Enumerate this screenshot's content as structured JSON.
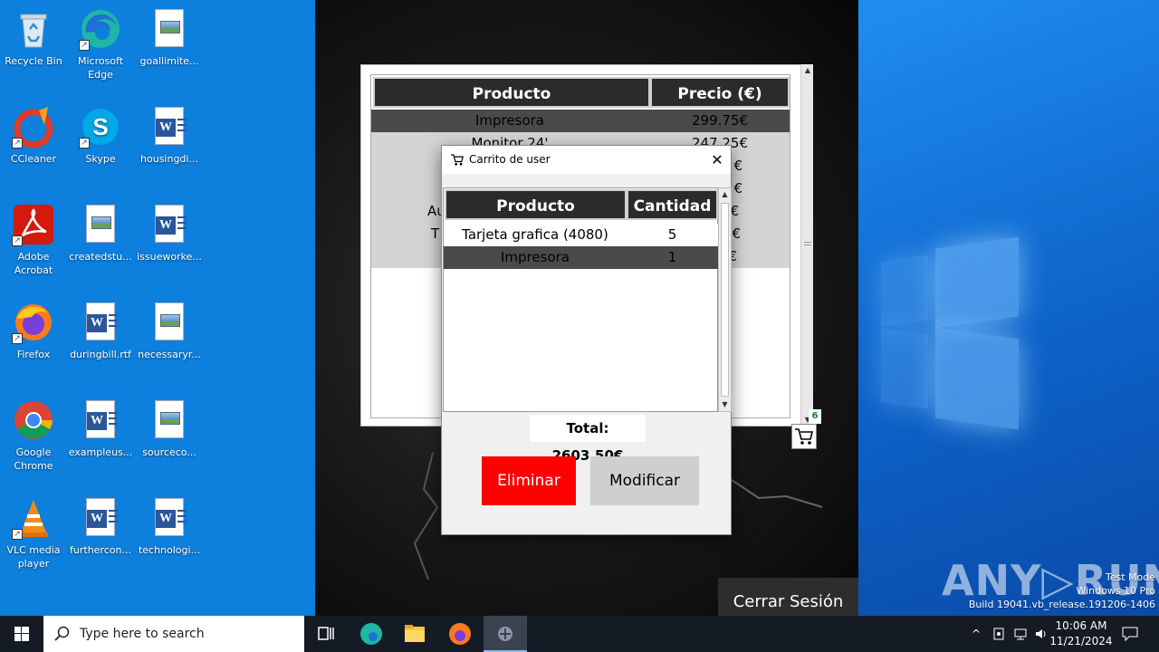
{
  "desktop": {
    "icons": [
      {
        "label": "Recycle Bin",
        "icon": "recycle-bin-icon"
      },
      {
        "label": "Microsoft Edge",
        "icon": "edge-icon"
      },
      {
        "label": "goallimite...",
        "icon": "image-file-icon"
      },
      {
        "label": "CCleaner",
        "icon": "ccleaner-icon"
      },
      {
        "label": "Skype",
        "icon": "skype-icon"
      },
      {
        "label": "housingdi...",
        "icon": "word-doc-icon"
      },
      {
        "label": "Adobe Acrobat",
        "icon": "acrobat-icon"
      },
      {
        "label": "createdstu...",
        "icon": "image-file-icon"
      },
      {
        "label": "issueworke...",
        "icon": "word-doc-icon"
      },
      {
        "label": "Firefox",
        "icon": "firefox-icon"
      },
      {
        "label": "duringbill.rtf",
        "icon": "word-doc-icon"
      },
      {
        "label": "necessaryr...",
        "icon": "image-file-icon"
      },
      {
        "label": "Google Chrome",
        "icon": "chrome-icon"
      },
      {
        "label": "exampleus...",
        "icon": "word-doc-icon"
      },
      {
        "label": "sourceco...",
        "icon": "image-file-icon"
      },
      {
        "label": "VLC media player",
        "icon": "vlc-icon"
      },
      {
        "label": "furthercon...",
        "icon": "word-doc-icon"
      },
      {
        "label": "technologi...",
        "icon": "word-doc-icon"
      }
    ]
  },
  "products": {
    "headers": {
      "product": "Producto",
      "price": "Precio (€)"
    },
    "rows": [
      {
        "name": "Impresora",
        "price": "299.75€"
      },
      {
        "name": "Monitor 24'",
        "price": "247.25€"
      },
      {
        "name": "",
        "price": "€"
      },
      {
        "name": "",
        "price": "€"
      },
      {
        "name": "Au",
        "price": "€"
      },
      {
        "name": "T",
        "price": "5€"
      },
      {
        "name": "",
        "price": "€"
      }
    ],
    "cart_count": "6"
  },
  "cart_dialog": {
    "title": "Carrito de user",
    "close": "✕",
    "headers": {
      "product": "Producto",
      "quantity": "Cantidad"
    },
    "rows": [
      {
        "name": "Tarjeta grafica (4080)",
        "qty": "5"
      },
      {
        "name": "Impresora",
        "qty": "1"
      }
    ],
    "total": "Total: 2603.50€",
    "delete_label": "Eliminar",
    "modify_label": "Modificar"
  },
  "app": {
    "logout_label": "Cerrar Sesión"
  },
  "watermark": {
    "brand": "ANY▷RUN",
    "line1": "Test Mode",
    "line2": "Windows 10 Pro",
    "line3": "Build 19041.vb_release.191206-1406"
  },
  "taskbar": {
    "search_placeholder": "Type here to search",
    "time": "10:06 AM",
    "date": "11/21/2024"
  },
  "colors": {
    "delete": "#ff0000",
    "header_bg": "#2b2b2b",
    "selected_row": "#4a4a4a",
    "desktop_blue": "#0d7fdc"
  }
}
